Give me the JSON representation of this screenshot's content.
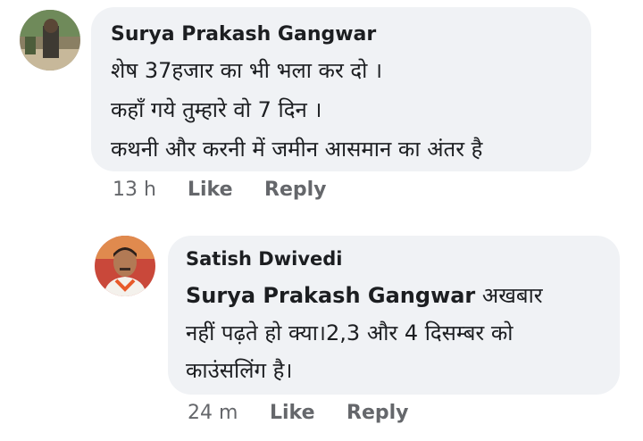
{
  "comment": {
    "author": "Surya Prakash Gangwar",
    "lines": [
      "शेष 37हजार का भी भला कर दो ।",
      "कहाँ गये तुम्हारे वो  7 दिन ।",
      "कथनी और करनी में जमीन आसमान का अंतर है"
    ],
    "time": "13 h",
    "like_label": "Like",
    "reply_label": "Reply"
  },
  "reply": {
    "author": "Satish Dwivedi",
    "mention": "Surya Prakash Gangwar",
    "lines": [
      " अखबार",
      "नहीं पढ़ते हो क्या।2,3 और 4 दिसम्बर को",
      "काउंसलिंग है।"
    ],
    "time": "24 m",
    "like_label": "Like",
    "reply_label": "Reply"
  }
}
